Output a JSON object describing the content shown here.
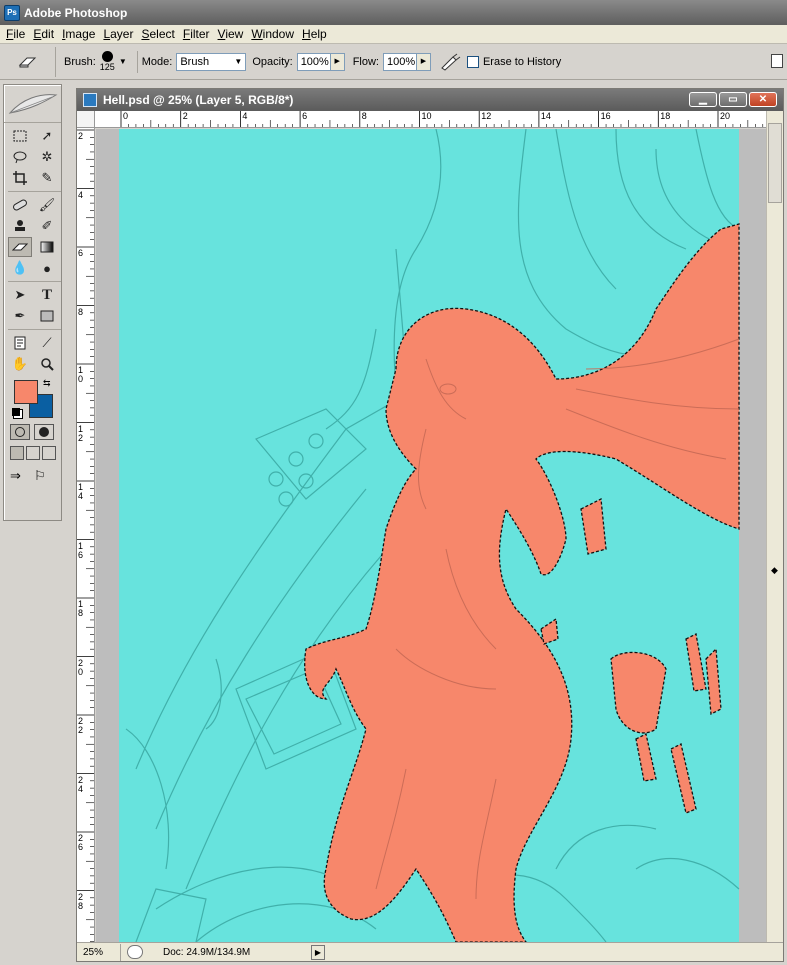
{
  "app": {
    "title": "Adobe Photoshop",
    "icon": "photoshop-icon"
  },
  "menu": [
    "File",
    "Edit",
    "Image",
    "Layer",
    "Select",
    "Filter",
    "View",
    "Window",
    "Help"
  ],
  "options": {
    "tool_icon": "eraser-icon",
    "brush_label": "Brush:",
    "brush_size": "125",
    "mode_label": "Mode:",
    "mode_value": "Brush",
    "opacity_label": "Opacity:",
    "opacity_value": "100%",
    "flow_label": "Flow:",
    "flow_value": "100%",
    "airbrush_icon": "airbrush-icon",
    "erase_history_label": "Erase to History",
    "erase_history_checked": false
  },
  "toolbox": {
    "tools": [
      "rect-marquee-icon",
      "move-icon",
      "lasso-icon",
      "magic-wand-icon",
      "crop-icon",
      "slice-icon",
      "healing-brush-icon",
      "brush-icon",
      "clone-stamp-icon",
      "history-brush-icon",
      "eraser-icon",
      "gradient-icon",
      "blur-icon",
      "dodge-icon",
      "path-select-icon",
      "type-icon",
      "pen-icon",
      "shape-icon",
      "notes-icon",
      "eyedropper-icon",
      "hand-icon",
      "zoom-icon"
    ],
    "active_tool": "eraser-icon",
    "foreground_color": "#f7876b",
    "background_color": "#0a5fa2"
  },
  "document": {
    "title": "Hell.psd @ 25% (Layer 5, RGB/8*)",
    "ruler_top": [
      "0",
      "2",
      "4",
      "6",
      "8",
      "10",
      "12",
      "14",
      "16",
      "18",
      "20"
    ],
    "ruler_left": [
      "2",
      "4",
      "6",
      "8",
      "10",
      "12",
      "14",
      "16",
      "18",
      "20",
      "22",
      "24",
      "26",
      "28"
    ],
    "canvas_bg": "#67e3dd",
    "selection_color": "#f7876b",
    "zoom": "25%",
    "doc_info": "Doc: 24.9M/134.9M"
  }
}
